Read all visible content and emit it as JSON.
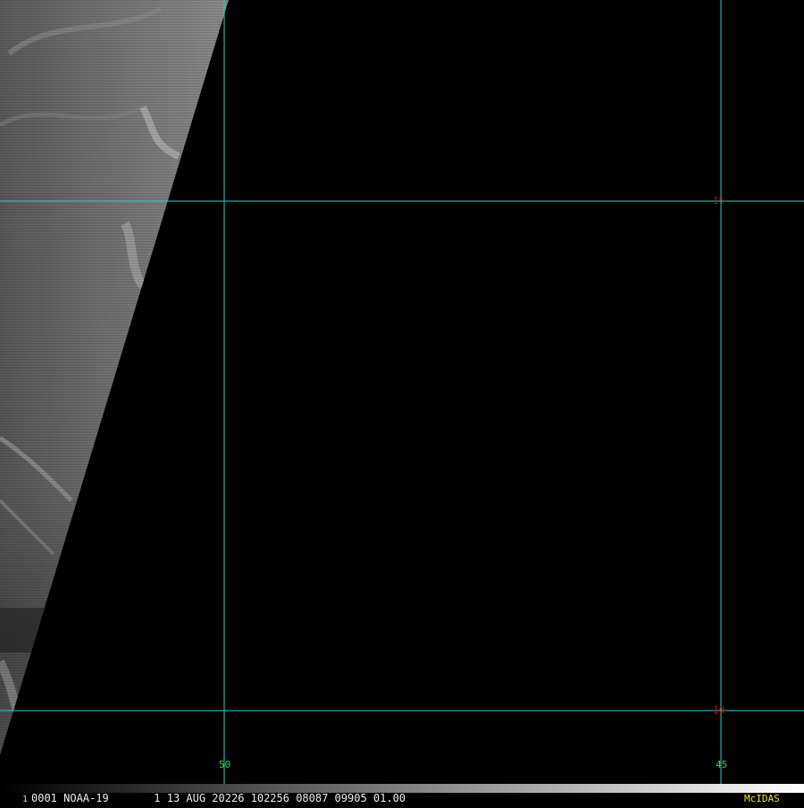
{
  "image": {
    "swath_side": "left",
    "background": "#000000",
    "swath_tone": "#6f6f6f"
  },
  "grid": {
    "color": "#22d0d0",
    "latitude_labels": [
      "15",
      "10"
    ],
    "longitude_labels": [
      "50",
      "45"
    ],
    "latitude_label_color": "#d01010",
    "longitude_label_color": "#33e033"
  },
  "status_bar": {
    "frame_number": "1",
    "info_text": "0001 NOAA-19       1 13 AUG 20226 102256 08087 09905 01.00",
    "brand": "McIDAS",
    "frame_color": "#e8e800",
    "text_color": "#f0f0f0",
    "brand_color": "#e8e800"
  }
}
